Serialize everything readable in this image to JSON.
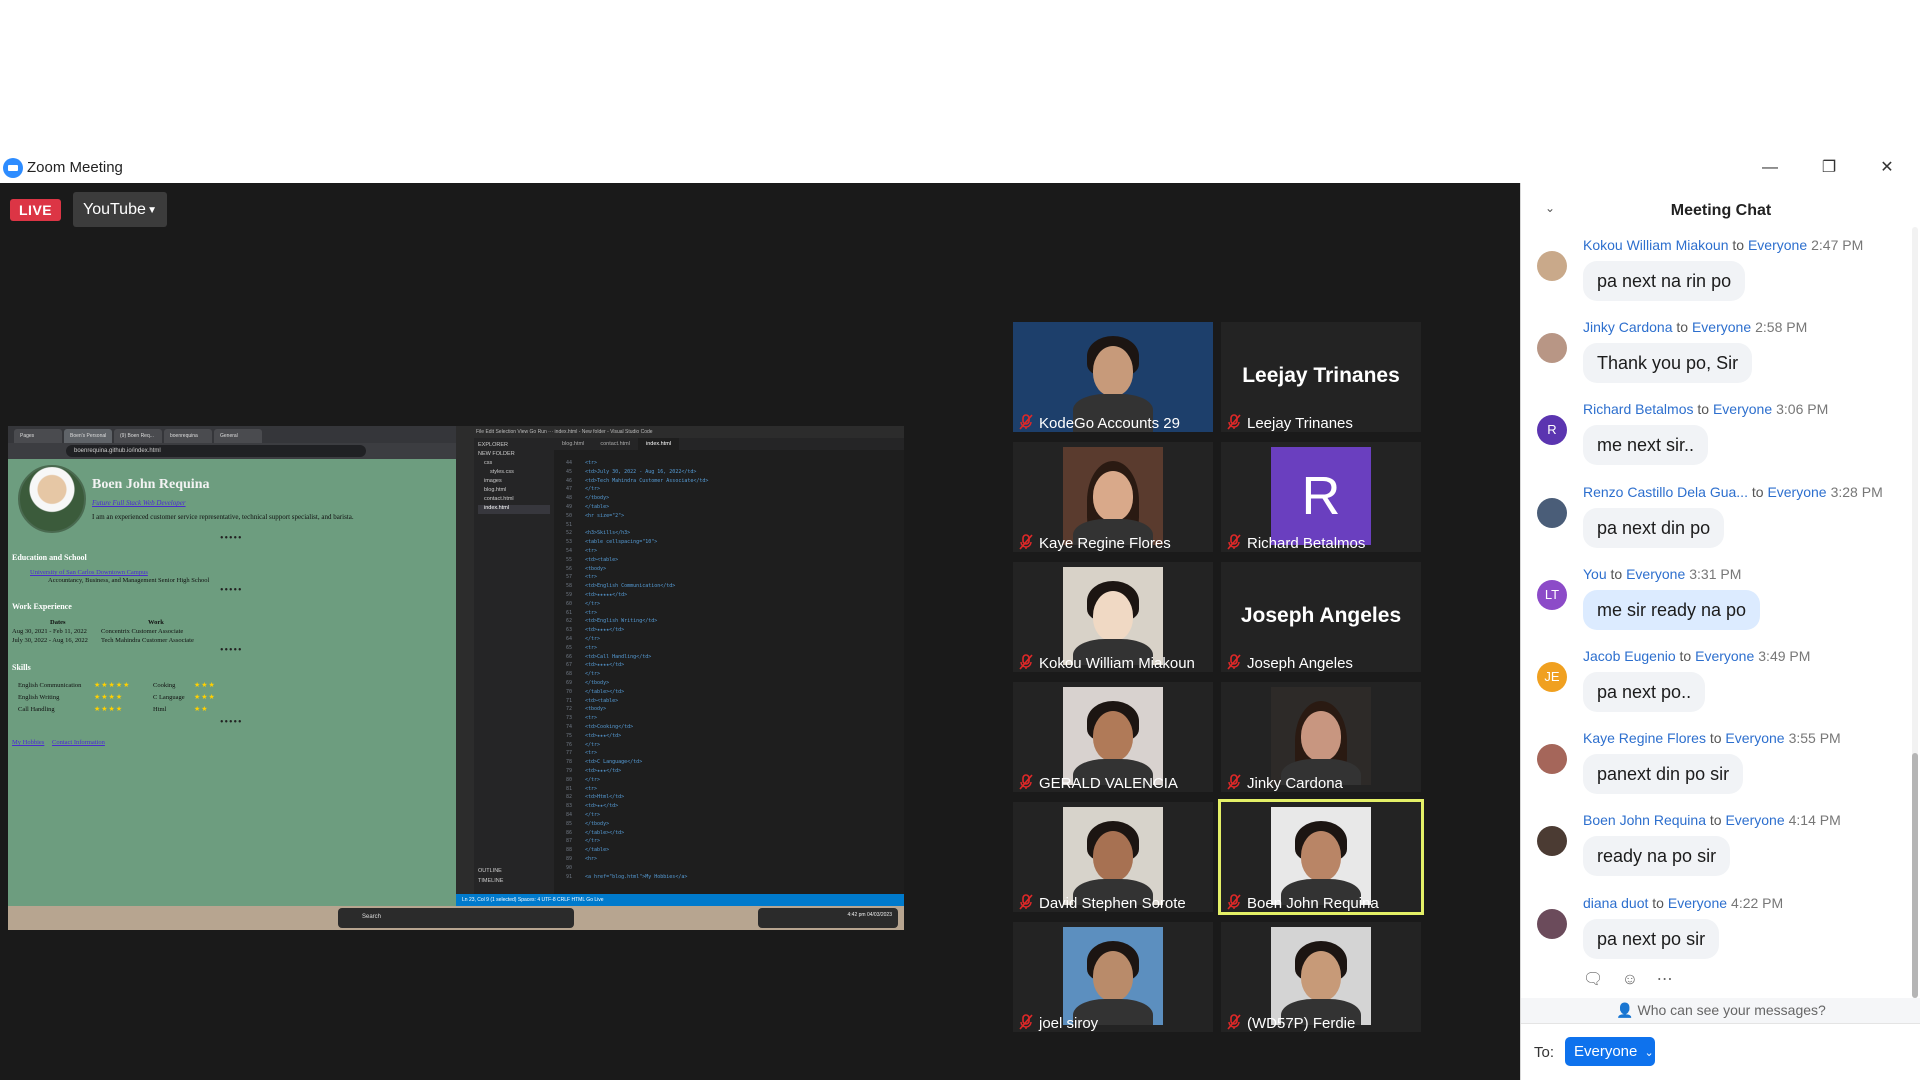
{
  "window": {
    "title": "Zoom Meeting",
    "minimize": "—",
    "restore": "❐",
    "close": "✕"
  },
  "stage": {
    "live_label": "LIVE",
    "stream_target": "YouTube"
  },
  "shared_screen": {
    "browser_tabs": [
      "Pages",
      "Boen's Personal",
      "(9) Boen Req...",
      "boenrequina",
      "General"
    ],
    "url": "boenrequina.github.io/index.html",
    "resume": {
      "name": "Boen John Requina",
      "role": "Future Full Stack Web Developer",
      "bio": "I am an experienced customer service representative, technical support specialist, and barista.",
      "education_heading": "Education and School",
      "school": "University of San Carlos Downtown Campus",
      "strand": "Accountancy, Business, and Management Senior High School",
      "work_heading": "Work Experience",
      "dates_header": "Dates",
      "work_header": "Work",
      "work_rows": [
        {
          "dates": "Aug 30, 2021 - Feb 11, 2022",
          "work": "Concentrix Customer Associate"
        },
        {
          "dates": "July 30, 2022 - Aug 16, 2022",
          "work": "Tech Mahindra Customer Associate"
        }
      ],
      "skills_heading": "Skills",
      "skills": [
        {
          "name": "English Communication",
          "stars": "★★★★★"
        },
        {
          "name": "English Writing",
          "stars": "★★★★"
        },
        {
          "name": "Call Handling",
          "stars": "★★★★"
        }
      ],
      "skills2": [
        {
          "name": "Cooking",
          "stars": "★★★"
        },
        {
          "name": "C Language",
          "stars": "★★★"
        },
        {
          "name": "Html",
          "stars": "★★"
        }
      ],
      "links": [
        "My Hobbies",
        "Contact Information"
      ]
    },
    "vscode": {
      "menu": "File  Edit  Selection  View  Go  Run  ···        index.html - New folder - Visual Studio Code",
      "explorer_title": "EXPLORER",
      "explorer_items": [
        "NEW FOLDER",
        "css",
        "styles.css",
        "images",
        "blog.html",
        "contact.html",
        "index.html"
      ],
      "tabs": [
        "blog.html",
        "contact.html",
        "index.html"
      ],
      "code": [
        {
          "n": "44",
          "t": "            <tr>"
        },
        {
          "n": "45",
          "t": "                <td>July 30, 2022 - Aug 16, 2022</td>"
        },
        {
          "n": "46",
          "t": "                <td>Tech Mahindra Customer Associate</td>"
        },
        {
          "n": "47",
          "t": "            </tr>"
        },
        {
          "n": "48",
          "t": "        </tbody>"
        },
        {
          "n": "49",
          "t": "    </table>"
        },
        {
          "n": "50",
          "t": "    <hr size=\"2\">"
        },
        {
          "n": "51",
          "t": ""
        },
        {
          "n": "52",
          "t": "    <h3>Skills</h3>"
        },
        {
          "n": "53",
          "t": "    <table cellspacing=\"10\">"
        },
        {
          "n": "54",
          "t": "        <tr>"
        },
        {
          "n": "55",
          "t": "            <td><table>"
        },
        {
          "n": "56",
          "t": "                <tbody>"
        },
        {
          "n": "57",
          "t": "                    <tr>"
        },
        {
          "n": "58",
          "t": "                        <td>English Communication</td>"
        },
        {
          "n": "59",
          "t": "                        <td>★★★★★</td>"
        },
        {
          "n": "60",
          "t": "                    </tr>"
        },
        {
          "n": "61",
          "t": "                    <tr>"
        },
        {
          "n": "62",
          "t": "                        <td>English Writing</td>"
        },
        {
          "n": "63",
          "t": "                        <td>★★★★</td>"
        },
        {
          "n": "64",
          "t": "                    </tr>"
        },
        {
          "n": "65",
          "t": "                    <tr>"
        },
        {
          "n": "66",
          "t": "                        <td>Call Handling</td>"
        },
        {
          "n": "67",
          "t": "                        <td>★★★★</td>"
        },
        {
          "n": "68",
          "t": "                    </tr>"
        },
        {
          "n": "69",
          "t": "                </tbody>"
        },
        {
          "n": "70",
          "t": "            </table></td>"
        },
        {
          "n": "71",
          "t": "            <td><table>"
        },
        {
          "n": "72",
          "t": "                <tbody>"
        },
        {
          "n": "73",
          "t": "                    <tr>"
        },
        {
          "n": "74",
          "t": "                        <td>Cooking</td>"
        },
        {
          "n": "75",
          "t": "                        <td>★★★</td>"
        },
        {
          "n": "76",
          "t": "                    </tr>"
        },
        {
          "n": "77",
          "t": "                    <tr>"
        },
        {
          "n": "78",
          "t": "                        <td>C Language</td>"
        },
        {
          "n": "79",
          "t": "                        <td>★★★</td>"
        },
        {
          "n": "80",
          "t": "                    </tr>"
        },
        {
          "n": "81",
          "t": "                    <tr>"
        },
        {
          "n": "82",
          "t": "                        <td>Html</td>"
        },
        {
          "n": "83",
          "t": "                        <td>★★</td>"
        },
        {
          "n": "84",
          "t": "                    </tr>"
        },
        {
          "n": "85",
          "t": "                </tbody>"
        },
        {
          "n": "86",
          "t": "            </table></td>"
        },
        {
          "n": "87",
          "t": "        </tr>"
        },
        {
          "n": "88",
          "t": "    </table>"
        },
        {
          "n": "89",
          "t": "    <hr>"
        },
        {
          "n": "90",
          "t": ""
        },
        {
          "n": "91",
          "t": "    <a href=\"blog.html\">My Hobbies</a>"
        }
      ],
      "status": "Ln 23, Col 9 (1 selected)   Spaces: 4   UTF-8   CRLF   HTML   Go Live",
      "outline": "OUTLINE",
      "timeline": "TIMELINE"
    },
    "taskbar": {
      "search": "Search",
      "clock": "4:42 pm  04/03/2023"
    }
  },
  "participants": [
    {
      "name": "KodeGo Accounts 29",
      "video": "kodego"
    },
    {
      "name": "Leejay Trinanes",
      "video": "none",
      "display_name": "Leejay Trinanes"
    },
    {
      "name": "Kaye Regine Flores",
      "video": "kaye"
    },
    {
      "name": "Richard Betalmos",
      "video": "initial",
      "initial": "R"
    },
    {
      "name": "Kokou William Miakoun",
      "video": "kokou"
    },
    {
      "name": "Joseph Angeles",
      "video": "none",
      "display_name": "Joseph Angeles"
    },
    {
      "name": "GERALD VALENCIA",
      "video": "gerald"
    },
    {
      "name": "Jinky Cardona",
      "video": "jinky"
    },
    {
      "name": "David Stephen Sorote",
      "video": "david"
    },
    {
      "name": "Boen John Requina",
      "video": "boen",
      "active_speaker": true
    },
    {
      "name": "joel siroy",
      "video": "joel"
    },
    {
      "name": "(WD57P) Ferdie",
      "video": "ferdie"
    }
  ],
  "chat": {
    "title": "Meeting Chat",
    "to_word": "to",
    "everyone_word": "Everyone",
    "messages": [
      {
        "sender": "Kokou William Miakoun",
        "time": "2:47 PM",
        "text": "pa next na rin po",
        "avatar_color": "#c9a98a",
        "initials": ""
      },
      {
        "sender": "Jinky Cardona",
        "time": "2:58 PM",
        "text": "Thank you po, Sir",
        "avatar_color": "#b89685",
        "initials": ""
      },
      {
        "sender": "Richard Betalmos",
        "time": "3:06 PM",
        "text": "me next sir..",
        "avatar_color": "#5b35b0",
        "initials": "R"
      },
      {
        "sender": "Renzo Castillo Dela Gua...",
        "time": "3:28 PM",
        "text": "pa next din po",
        "avatar_color": "#4a5d78",
        "initials": ""
      },
      {
        "sender": "You",
        "time": "3:31 PM",
        "text": "me sir ready na po",
        "avatar_color": "#8c4bc8",
        "initials": "LT",
        "mine": true
      },
      {
        "sender": "Jacob Eugenio",
        "time": "3:49 PM",
        "text": "pa next po..",
        "avatar_color": "#f0a020",
        "initials": "JE"
      },
      {
        "sender": "Kaye Regine Flores",
        "time": "3:55 PM",
        "text": "panext din po sir",
        "avatar_color": "#a5665a",
        "initials": ""
      },
      {
        "sender": "Boen John Requina",
        "time": "4:14 PM",
        "text": "ready na po sir",
        "avatar_color": "#4b3b33",
        "initials": ""
      },
      {
        "sender": "diana duot",
        "time": "4:22 PM",
        "text": "pa next po sir",
        "avatar_color": "#6b4b5b",
        "initials": ""
      }
    ],
    "privacy_text": "Who can see your messages?",
    "to_label": "To:",
    "recipient": "Everyone",
    "colors": {
      "accent": "#0e72ed",
      "sender": "#2d6fce",
      "live": "#dc3545",
      "active_speaker": "#e4f067"
    }
  }
}
